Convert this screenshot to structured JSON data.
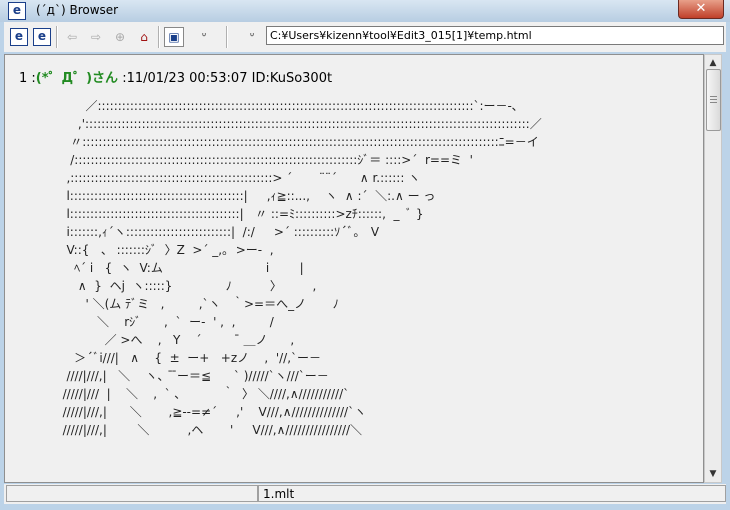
{
  "window": {
    "title": "(´д`) Browser",
    "close_glyph": "✕"
  },
  "toolbar": {
    "address": "C:¥Users¥kizenn¥tool¥Edit3_015[1]¥temp.html",
    "buttons": [
      {
        "name": "e-browser-button-1",
        "icon": "e",
        "icon_name": "browser-e-icon"
      },
      {
        "name": "e-browser-button-2",
        "icon": "e",
        "icon_name": "browser-e-icon"
      },
      {
        "name": "back-button",
        "icon": "⇦",
        "icon_name": "back-arrow-icon"
      },
      {
        "name": "forward-button",
        "icon": "⇨",
        "icon_name": "forward-arrow-icon"
      },
      {
        "name": "stop-button",
        "icon": "⊕",
        "icon_name": "stop-icon"
      },
      {
        "name": "home-button",
        "icon": "⌂",
        "icon_name": "home-icon"
      },
      {
        "name": "view-button",
        "icon": "▣",
        "icon_name": "view-icon"
      },
      {
        "name": "aa-face-button",
        "icon": "ᐡ",
        "icon_name": "aa-face-icon"
      },
      {
        "name": "address-face-button",
        "icon": "ᐡ",
        "icon_name": "aa-face-icon"
      }
    ]
  },
  "post": {
    "number": "1",
    "separator": " :",
    "name": "(*゜Д゜)さん",
    "meta": " :11/01/23 00:53:07 ID:KuSo300t",
    "ascii_art": "        ／:::::::::::::::::::::::::::::::::::::::::::::::::::::::::::::::::::::::::::::::::::::::::::::`:ー－-､\n      ,'::::::::::::::::::::::::::::::::::::::::::::::::::::::::::::::::::::::::::::::::::::::::::::::::::::::::::::::／\n    〃:::::::::::::::::::::::::::::::::::::::::::::::::::::::::::::::::::::::::::::::::::::::::::::::::::::::ﾆ=－イ\n    /::::::::::::::::::::::::::::::::::::::::::::::::::::::::::::::::::::::ｼﾞ＝ ::::>´  r==ミ  '\n   ,::::::::::::::::::::::::::::::::::::::::::::::::::> ´       ¨¨´      ∧ r.:::::: ヽ\n   l:::::::::::::::::::::::::::::::::::::::::::|     ,ｨ≧::...,    ヽ  ∧ :´  ＼:.∧ ー っ\n   l::::::::::::::::::::::::::::::::::::::::::|   〃 ::=ﾐ::::::::::>zﾁ::::::,  _  ﾞ }\n   i:::::::,ｨ´ヽ::::::::::::::::::::::::::|  /:/     >´ ::::::::::ｿ´ﾞ｡   V\n   V::{   、 :::::::ｼﾞ  〉Z  >´ _,｡  >ー-  ,\n     ﾍ´ i   {  ヽ  V:ム                           i        |\n      ∧  }  ヘj  ヽ:::::}              ﾉ          〉        ,\n        ' ＼(ム ﾃﾞミ   ,         ,`ヽ   ｀>=＝へ_ノ       ﾉ\n           ＼    rｼﾞ      ,  `  ー-  ' ,  ,         /\n             ／ >へ    ,   Y    ´          ̄ ＿ノ      ,\n     ＞´ﾞi///|   ∧    {  ±  ー+   +zノ    ,  '//,`ー－\n   ////|///,|   ＼    ヽ、 ̄ ̄ー＝≦      ` )/////`ヽ///`ー－\n  /////|///  |    ＼    ,  ` ､           ｀  〉 ＼////,∧///////////`\n  /////|///,|      ＼       ,≧--=≠´     ,'    V///,∧//////////////`ヽ\n  /////|///,|        ＼          ,ヘ       '     V///,∧////////////////＼"
  },
  "status": {
    "file": "1.mlt"
  },
  "colors": {
    "name_color": "#228b22",
    "titlebar": "#c9dbed",
    "close": "#c84a34"
  }
}
